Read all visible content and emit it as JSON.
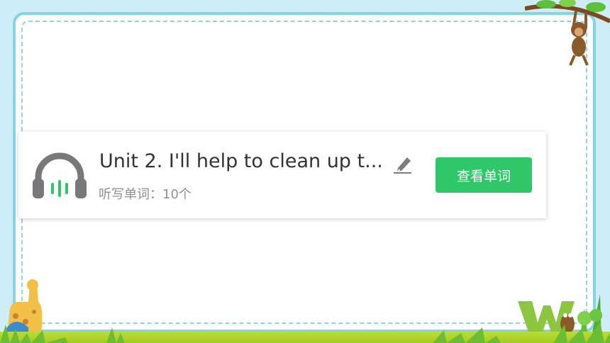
{
  "record": {
    "title": "Unit 2. I'll help to clean up t...",
    "subtitle": "听写单词：10个",
    "view_words_button": "查看单词",
    "headphone_icon": "headphone-icon",
    "edit_icon": "pencil-icon"
  },
  "colors": {
    "accent": "#2fc76a",
    "frame_border": "#86d3e3",
    "background": "#cdeef6",
    "grass": "#a4cd1c"
  }
}
